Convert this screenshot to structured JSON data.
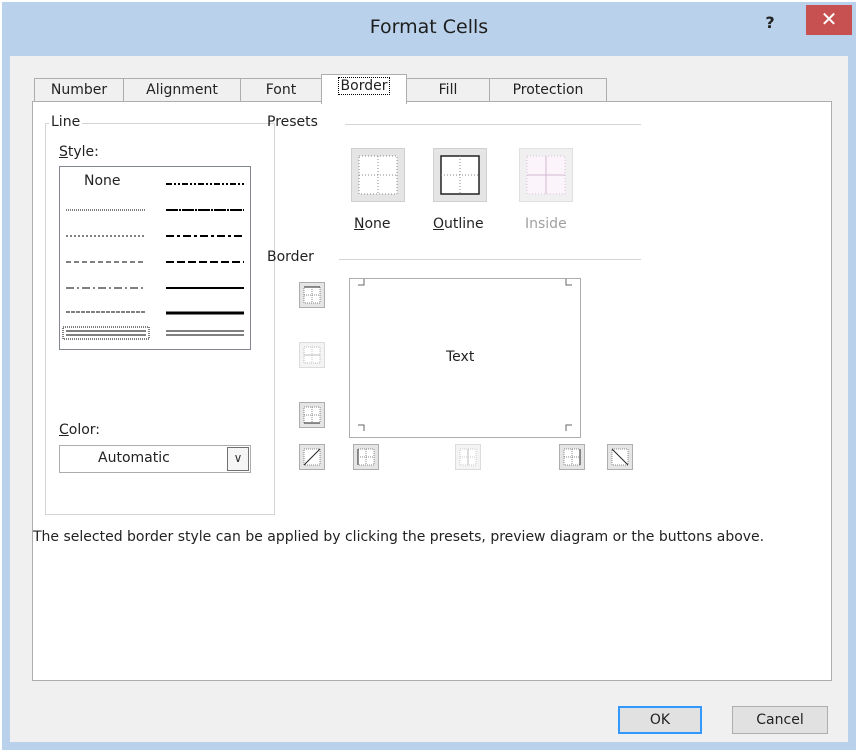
{
  "dialog": {
    "title": "Format Cells",
    "help_label": "?",
    "close_label": "✕"
  },
  "tabs": [
    {
      "label": "Number"
    },
    {
      "label": "Alignment"
    },
    {
      "label": "Font"
    },
    {
      "label": "Border",
      "active": true
    },
    {
      "label": "Fill"
    },
    {
      "label": "Protection"
    }
  ],
  "line": {
    "group_label": "Line",
    "style_label": "Style:",
    "style_mnemonic": "S",
    "style_rest": "tyle:",
    "none_label": "None",
    "color_label": "Color:",
    "color_mnemonic": "C",
    "color_rest": "olor:",
    "color_value": "Automatic"
  },
  "presets": {
    "group_label": "Presets",
    "items": [
      {
        "label": "None",
        "mnemonic": "N",
        "rest": "one"
      },
      {
        "label": "Outline",
        "mnemonic": "O",
        "rest": "utline"
      },
      {
        "label": "Inside",
        "disabled": true
      }
    ]
  },
  "border": {
    "group_label": "Border",
    "preview_text": "Text"
  },
  "description": "The selected border style can be applied by clicking the presets, preview diagram or the buttons above.",
  "buttons": {
    "ok": "OK",
    "cancel": "Cancel"
  },
  "colors": {
    "title_bar": "#b9d1ea",
    "close_button": "#c75050",
    "dialog_bg": "#f0f0f0",
    "default_button_border": "#3399ff"
  }
}
